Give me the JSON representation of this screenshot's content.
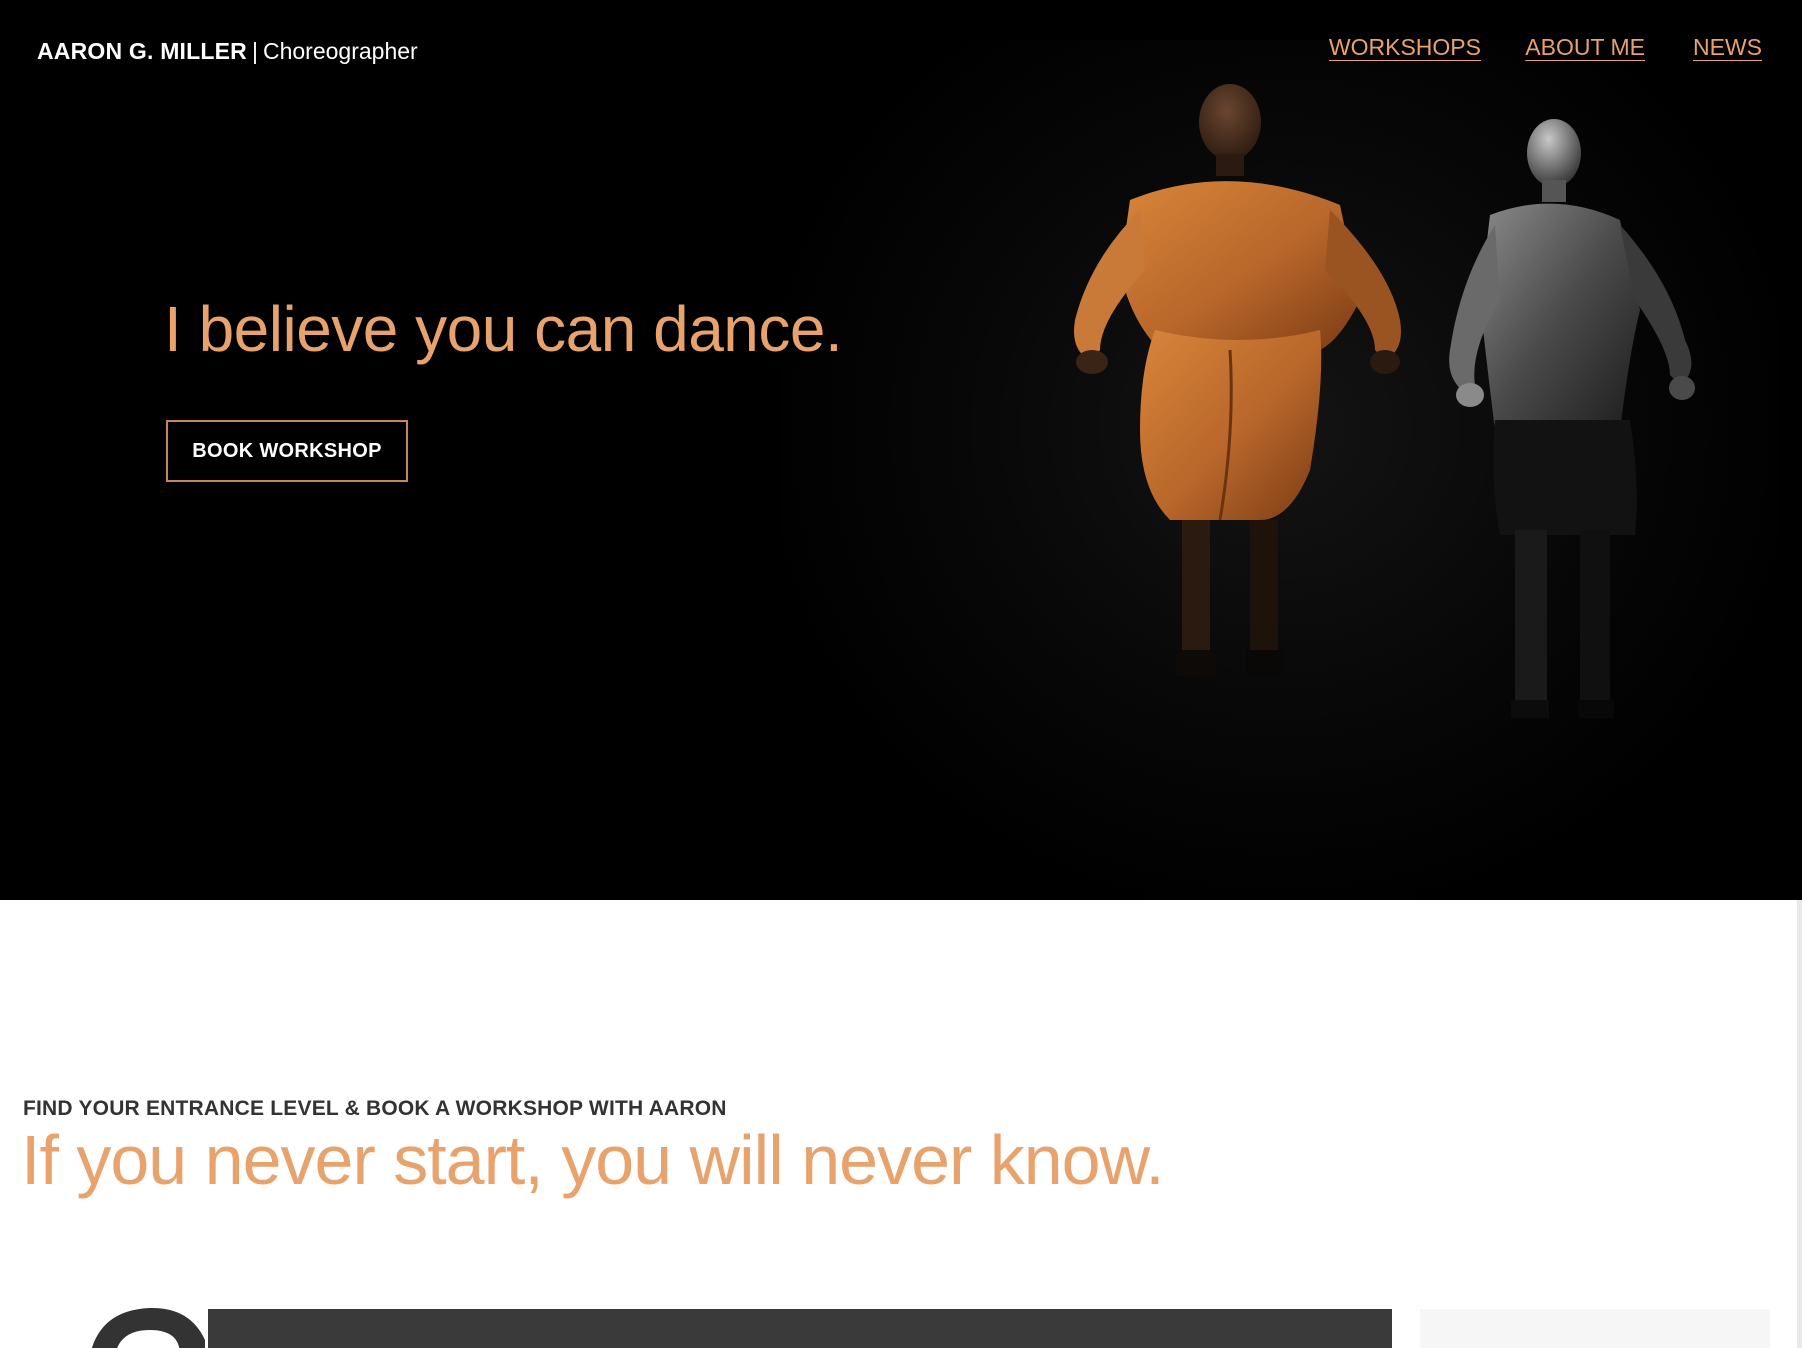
{
  "header": {
    "brand_name": "AARON G. MILLER",
    "brand_separator": "|",
    "brand_role": "Choreographer"
  },
  "nav": {
    "items": [
      {
        "label": "WORKSHOPS"
      },
      {
        "label": "ABOUT ME"
      },
      {
        "label": "NEWS"
      }
    ]
  },
  "hero": {
    "title": "I believe you can dance.",
    "cta_label": "BOOK WORKSHOP",
    "image": "two-dancers-jumping-photo"
  },
  "entrance": {
    "eyebrow": "FIND YOUR ENTRANCE LEVEL & BOOK A WORKSHOP WITH AARON",
    "title": "If you never start, you will never know."
  },
  "colors": {
    "accent": "#e8a26b",
    "hero_background": "#000000",
    "card_dark": "#3a3a3a",
    "card_light": "#f6f6f6",
    "eyebrow_text": "#333333"
  }
}
